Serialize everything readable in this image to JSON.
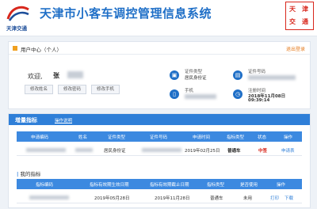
{
  "header": {
    "logo_text": "天津交通",
    "title": "天津市小客车调控管理信息系统",
    "stamp_chars": [
      "天",
      "津",
      "交",
      "通"
    ]
  },
  "user_center": {
    "title": "用户中心（个人）",
    "logout": "退出登录",
    "greeting": "欢迎,",
    "name_visible": "张",
    "buttons": [
      "修改姓名",
      "修改密码",
      "修改手机"
    ],
    "id_type_label": "证件类型",
    "id_type_value": "居民身份证",
    "id_number_label": "证件号码",
    "phone_label": "手机",
    "register_label": "注册时间",
    "register_date": "2018年11月08日",
    "register_time": "09:39:14"
  },
  "increment_panel": {
    "title": "增量指标",
    "op_help": "操作说明",
    "columns": [
      "申请编码",
      "姓名",
      "证件类型",
      "证件号码",
      "申请时间",
      "指标类型",
      "状态",
      "操作"
    ],
    "row": {
      "id_type": "居民身份证",
      "apply_time": "2019年02月25日",
      "quota_type": "普通车",
      "status": "中签",
      "action": "申请表"
    }
  },
  "my_quota": {
    "title": "我的指标",
    "columns": [
      "指标编码",
      "指标有效期生效日期",
      "指标有效期截止日期",
      "指标类型",
      "是否使用",
      "操作"
    ],
    "row": {
      "start_date": "2019年05月28日",
      "end_date": "2019年11月28日",
      "quota_type": "普通车",
      "used": "未用",
      "print": "打印",
      "download": "下载"
    }
  },
  "colors": {
    "brand_blue": "#1f6fc7",
    "panel_blue": "#2f7fd8",
    "logout_orange": "#e67e22",
    "status_red": "#d8271c"
  }
}
